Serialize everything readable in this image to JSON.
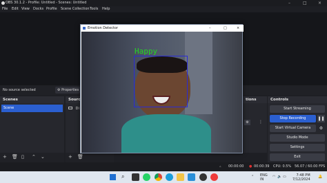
{
  "window_title": "OBS 30.1.2 - Profile: Untitled - Scenes: Untitled",
  "menu": [
    "File",
    "Edit",
    "View",
    "Docks",
    "Profile",
    "Scene Collection",
    "Tools",
    "Help"
  ],
  "source_bar": {
    "no_source": "No source selected",
    "properties_label": "Properties"
  },
  "scenes": {
    "header": "Scenes",
    "items": [
      "Scene"
    ]
  },
  "sources": {
    "header": "Sources",
    "items": [
      "Di"
    ]
  },
  "transitions": {
    "header": "tions"
  },
  "controls": {
    "header": "Controls",
    "buttons": [
      "Start Streaming",
      "Stop Recording",
      "Start Virtual Camera",
      "Studio Mode",
      "Settings",
      "Exit"
    ]
  },
  "status": {
    "rec_time": "00:00:00",
    "rec_time2": "00:00:39",
    "cpu": "CPU: 0.5%",
    "fps": "56.07 / 60.00 FPS"
  },
  "dialog": {
    "title": "Emotion Detector",
    "emotion_label": "Happy",
    "box_color": "#2a2ad6",
    "label_color": "#23d823"
  },
  "taskbar": {
    "lang_top": "ENG",
    "lang_bottom": "IN",
    "time": "7:48 PM",
    "date": "7/12/2024"
  }
}
